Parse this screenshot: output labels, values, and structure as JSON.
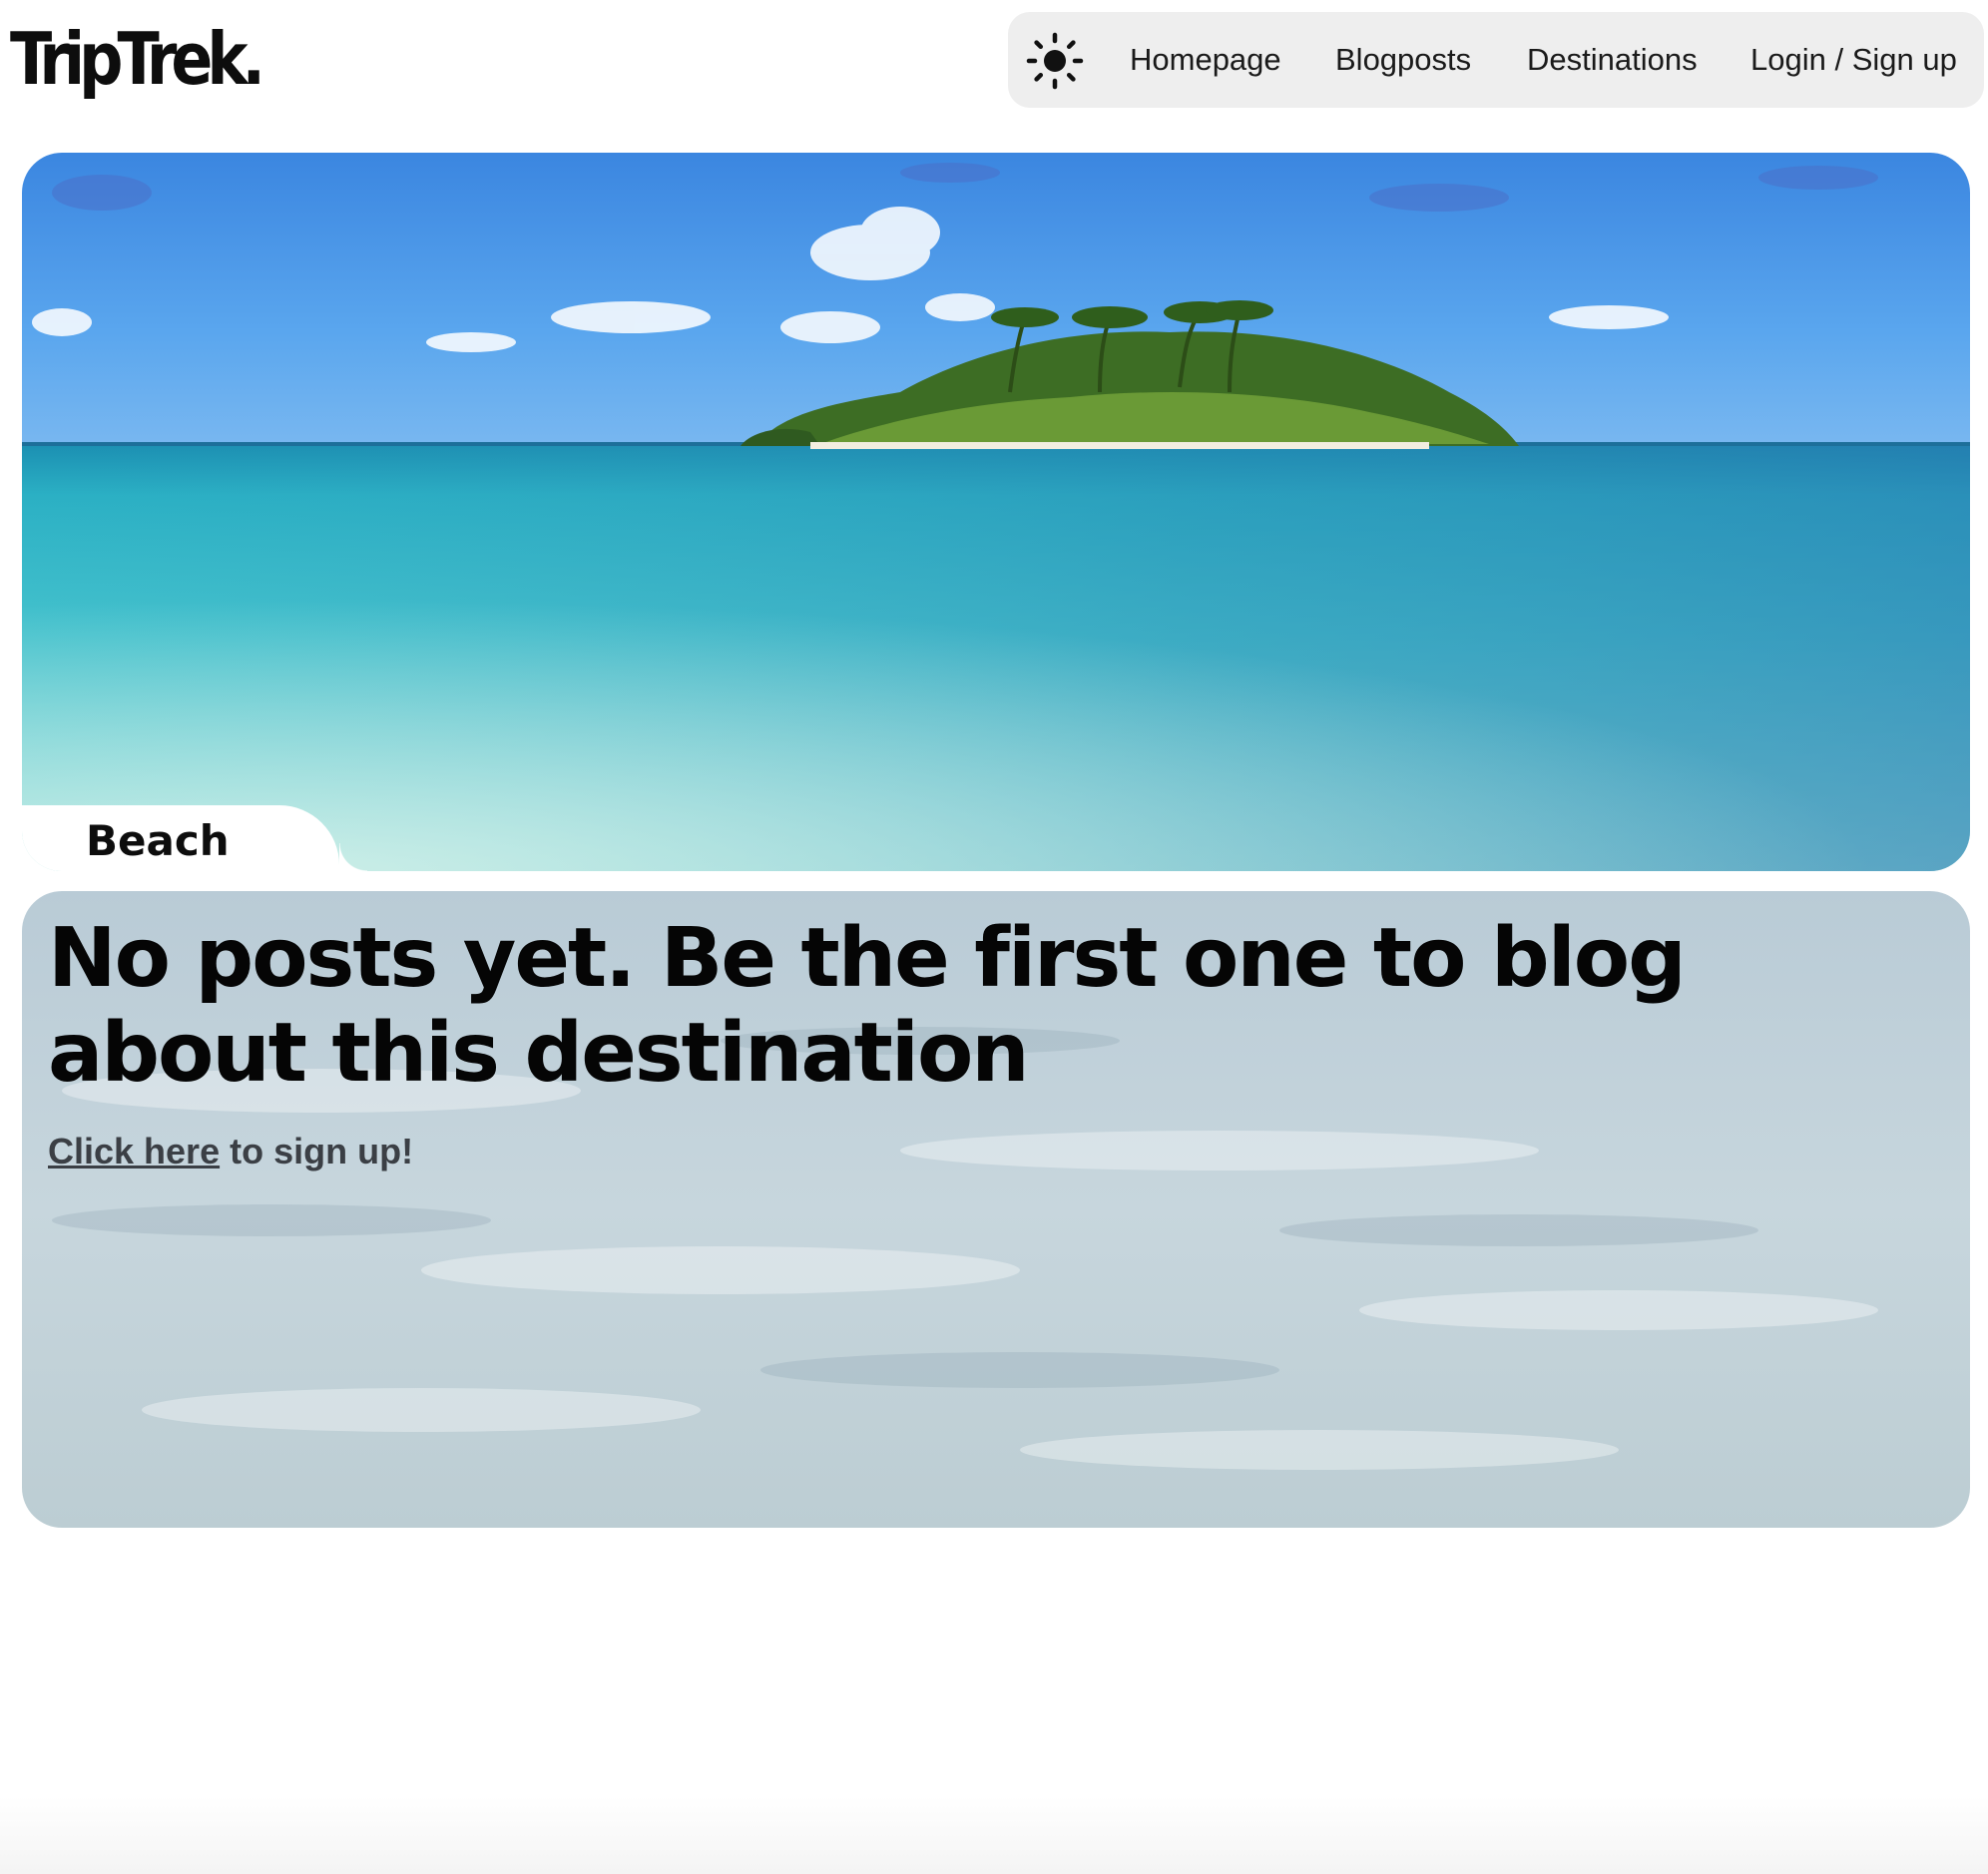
{
  "header": {
    "logo": "TripTrek.",
    "theme_icon": "sun-icon",
    "nav": {
      "homepage": "Homepage",
      "blogposts": "Blogposts",
      "destinations": "Destinations",
      "login": "Login / Sign up"
    }
  },
  "hero": {
    "category": "Beach"
  },
  "posts": {
    "empty_heading": "No posts yet. Be the first one to blog about this destination",
    "cta_link": "Click here",
    "cta_rest": " to sign up!"
  },
  "colors": {
    "nav_background": "#eeeeee",
    "sky": "#4f9be8",
    "sea": "#3fc0c9",
    "text": "#0d0d0d",
    "link": "#3b3f45"
  }
}
